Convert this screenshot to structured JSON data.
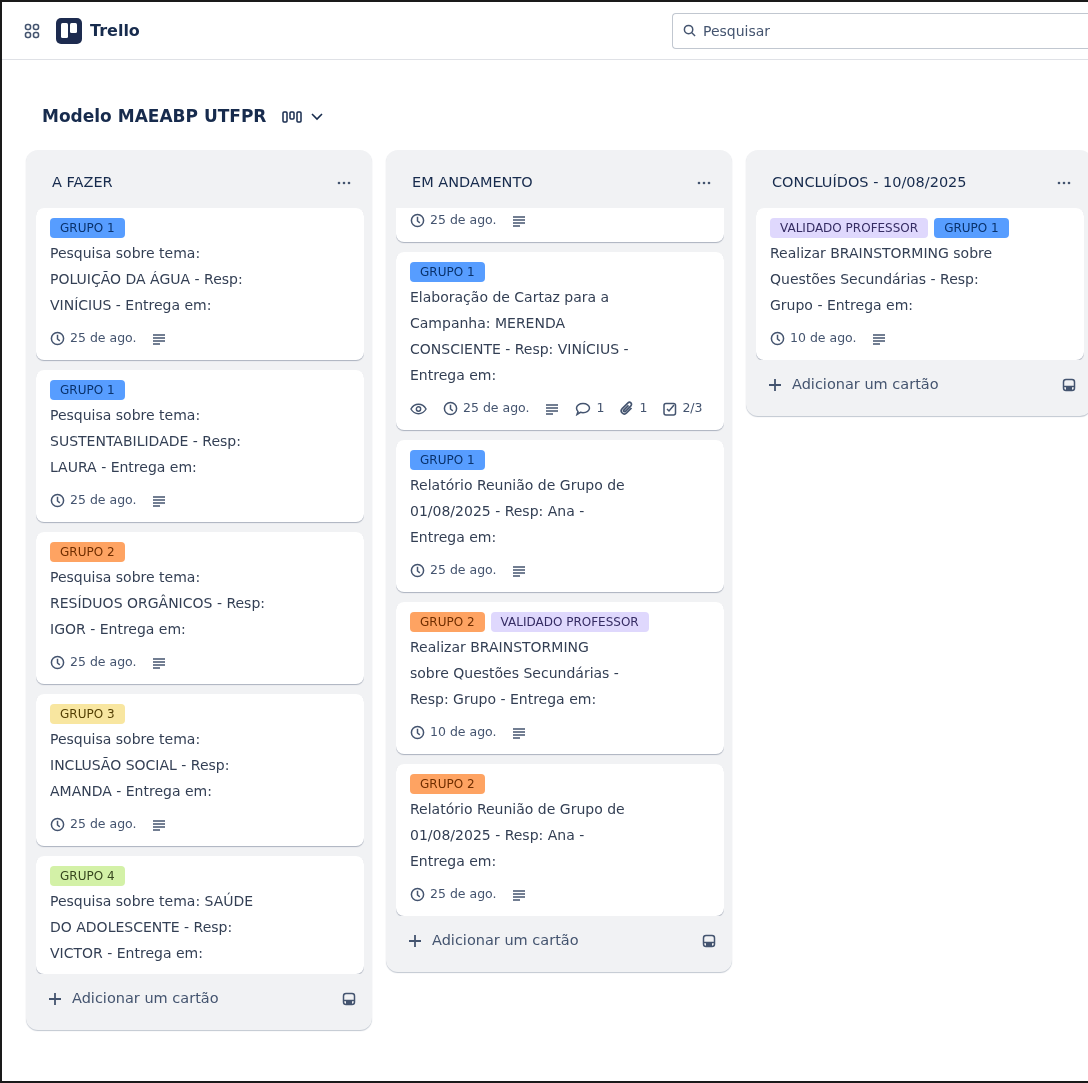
{
  "app": {
    "name": "Trello"
  },
  "search": {
    "placeholder": "Pesquisar"
  },
  "board": {
    "title": "Modelo MAEABP UTFPR"
  },
  "lists": [
    {
      "title": "A FAZER",
      "add_label": "Adicionar um cartão",
      "cards": [
        {
          "labels": [
            {
              "text": "GRUPO 1",
              "color": "#579dff"
            }
          ],
          "title": "Pesquisa sobre tema:\nPOLUIÇÃO DA ÁGUA - Resp:\nVINÍCIUS - Entrega em:",
          "badges": [
            {
              "kind": "due",
              "text": "25 de ago."
            },
            {
              "kind": "description"
            }
          ]
        },
        {
          "labels": [
            {
              "text": "GRUPO 1",
              "color": "#579dff"
            }
          ],
          "title": "Pesquisa sobre tema:\nSUSTENTABILIDADE - Resp:\nLAURA - Entrega em:",
          "badges": [
            {
              "kind": "due",
              "text": "25 de ago."
            },
            {
              "kind": "description"
            }
          ]
        },
        {
          "labels": [
            {
              "text": "GRUPO 2",
              "color": "#fea362"
            }
          ],
          "title": "Pesquisa sobre tema:\nRESÍDUOS ORGÂNICOS - Resp:\nIGOR - Entrega em:",
          "badges": [
            {
              "kind": "due",
              "text": "25 de ago."
            },
            {
              "kind": "description"
            }
          ]
        },
        {
          "labels": [
            {
              "text": "GRUPO 3",
              "color": "#f8e6a0"
            }
          ],
          "title": "Pesquisa sobre tema:\nINCLUSÃO SOCIAL - Resp:\nAMANDA - Entrega em:",
          "badges": [
            {
              "kind": "due",
              "text": "25 de ago."
            },
            {
              "kind": "description"
            }
          ]
        },
        {
          "labels": [
            {
              "text": "GRUPO 4",
              "color": "#d3f1a7"
            }
          ],
          "title": "Pesquisa sobre tema: SAÚDE\nDO ADOLESCENTE - Resp:\nVICTOR - Entrega em:"
        }
      ]
    },
    {
      "title": "EM ANDAMENTO",
      "add_label": "Adicionar um cartão",
      "cards": [
        {
          "badges": [
            {
              "kind": "due",
              "text": "25 de ago."
            },
            {
              "kind": "description"
            }
          ]
        },
        {
          "labels": [
            {
              "text": "GRUPO 1",
              "color": "#579dff"
            }
          ],
          "title": "Elaboração de Cartaz para a\nCampanha: MERENDA\nCONSCIENTE - Resp: VINÍCIUS -\nEntrega em:",
          "badges": [
            {
              "kind": "watch"
            },
            {
              "kind": "due",
              "text": "25 de ago."
            },
            {
              "kind": "description"
            },
            {
              "kind": "comments",
              "text": "1"
            },
            {
              "kind": "attachments",
              "text": "1"
            },
            {
              "kind": "checklist",
              "text": "2/3"
            }
          ]
        },
        {
          "labels": [
            {
              "text": "GRUPO 1",
              "color": "#579dff"
            }
          ],
          "title": "Relatório Reunião de Grupo de\n01/08/2025 - Resp: Ana -\nEntrega em:",
          "badges": [
            {
              "kind": "due",
              "text": "25 de ago."
            },
            {
              "kind": "description"
            }
          ]
        },
        {
          "labels": [
            {
              "text": "GRUPO 2",
              "color": "#fea362"
            },
            {
              "text": "VALIDADO PROFESSOR",
              "color": "#dfd8fd"
            }
          ],
          "title": "Realizar BRAINSTORMING\nsobre Questões Secundárias -\nResp: Grupo - Entrega em:",
          "badges": [
            {
              "kind": "due",
              "text": "10 de ago."
            },
            {
              "kind": "description"
            }
          ]
        },
        {
          "labels": [
            {
              "text": "GRUPO 2",
              "color": "#fea362"
            }
          ],
          "title": "Relatório Reunião de Grupo de\n01/08/2025 - Resp: Ana -\nEntrega em:",
          "badges": [
            {
              "kind": "due",
              "text": "25 de ago."
            },
            {
              "kind": "description"
            }
          ]
        }
      ]
    },
    {
      "title": "CONCLUÍDOS - 10/08/2025",
      "add_label": "Adicionar um cartão",
      "cards": [
        {
          "labels": [
            {
              "text": "VALIDADO PROFESSOR",
              "color": "#dfd8fd"
            },
            {
              "text": "GRUPO 1",
              "color": "#579dff"
            }
          ],
          "title": "Realizar BRAINSTORMING sobre\nQuestões Secundárias - Resp:\nGrupo - Entrega em:",
          "badges": [
            {
              "kind": "due",
              "text": "10 de ago."
            },
            {
              "kind": "description"
            }
          ]
        }
      ]
    }
  ]
}
